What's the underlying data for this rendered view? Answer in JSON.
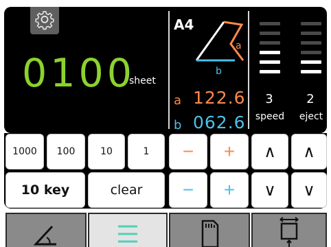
{
  "display": {
    "settings_icon": "gear-icon",
    "count_value": "0100",
    "count_unit": "sheet",
    "paper_size": "A4",
    "diagram": {
      "a_label": "a",
      "b_label": "b"
    },
    "a_label": "a",
    "a_value": "122.6",
    "b_label": "b",
    "b_value": "062.6",
    "speed": {
      "value": "3",
      "label": "speed",
      "level": 3,
      "max": 6
    },
    "eject": {
      "value": "2",
      "label": "eject",
      "level": 2,
      "max": 6
    },
    "colors": {
      "count": "#8cd22e",
      "a": "#ff8a4a",
      "b": "#4ec1e8"
    }
  },
  "keys": {
    "k1000": "1000",
    "k100": "100",
    "k10": "10",
    "k1": "1",
    "tenkey": "10 key",
    "clear": "clear",
    "a_minus": "−",
    "a_plus": "+",
    "b_minus": "−",
    "b_plus": "+",
    "speed_up": "∧",
    "speed_down": "∨",
    "eject_up": "∧",
    "eject_down": "∨"
  },
  "tabs": [
    {
      "name": "fold-angle-tab",
      "icon": "angle-icon",
      "active": false
    },
    {
      "name": "menu-tab",
      "icon": "menu-lines-icon",
      "active": true
    },
    {
      "name": "card-tab",
      "icon": "sd-card-icon",
      "active": false
    },
    {
      "name": "size-tab",
      "icon": "resize-icon",
      "active": false
    }
  ]
}
